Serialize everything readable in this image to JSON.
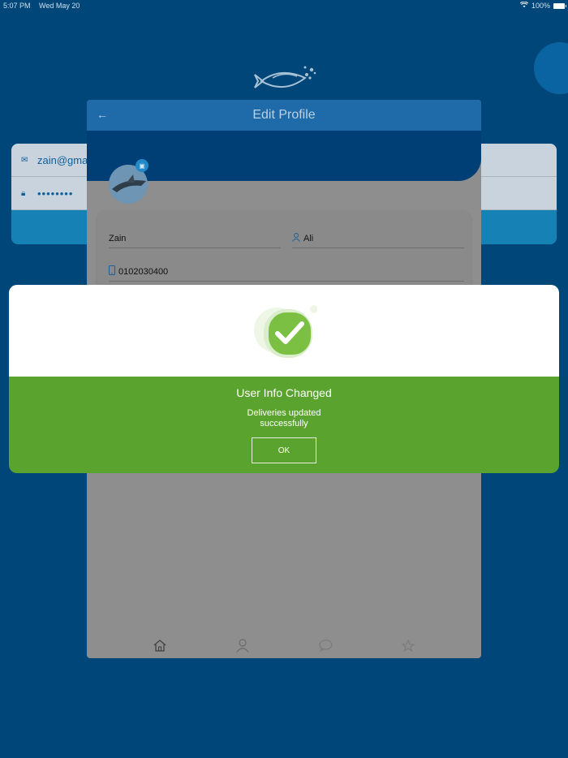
{
  "status_bar": {
    "time": "5:07 PM",
    "date": "Wed May 20",
    "battery": "100%"
  },
  "login": {
    "email": "zain@gmail.",
    "password": "••••••••"
  },
  "edit_profile": {
    "title": "Edit Profile",
    "first_name": "Zain",
    "last_name": "Ali",
    "phone": "0102030400"
  },
  "alert": {
    "title": "User Info Changed",
    "message_line1": "Deliveries updated",
    "message_line2": "successfully",
    "ok_label": "OK"
  },
  "icons": {
    "back": "arrow-left-icon",
    "camera": "camera-icon",
    "user": "user-icon",
    "phone": "phone-icon",
    "mail": "mail-icon",
    "lock": "lock-icon",
    "home": "home-icon",
    "chat": "chat-icon",
    "star": "star-icon",
    "check": "checkmark-icon"
  },
  "colors": {
    "background": "#004679",
    "header": "#1f6aa8",
    "alert_green": "#5aa32f",
    "check_green": "#7bc043"
  }
}
